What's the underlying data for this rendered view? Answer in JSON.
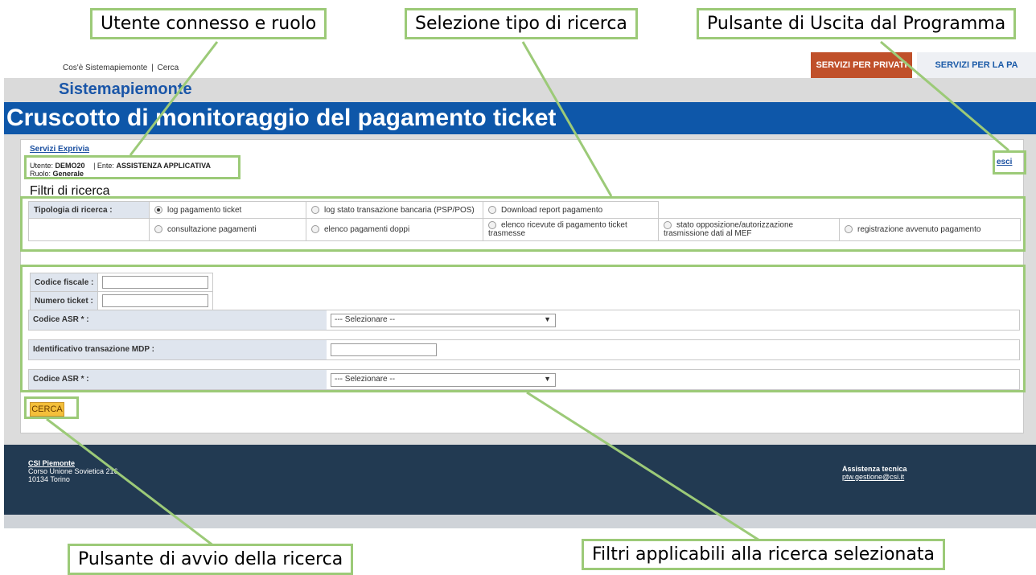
{
  "annotations": {
    "user_role": "Utente connesso e ruolo",
    "search_type": "Selezione tipo di ricerca",
    "exit": "Pulsante di Uscita dal Programma",
    "search_button": "Pulsante di avvio della ricerca",
    "filters": "Filtri applicabili alla ricerca selezionata"
  },
  "topnav": {
    "about": "Cos'è Sistemapiemonte",
    "separator": "|",
    "search": "Cerca",
    "private_services": "SERVIZI PER PRIVATI",
    "pa_services": "SERVIZI PER LA PA"
  },
  "brand": "Sistemapiemonte",
  "title": "Cruscotto di monitoraggio del pagamento ticket",
  "session": {
    "services_link": "Servizi Exprivia",
    "user_label": "Utente:",
    "user": "DEMO20",
    "ente_label": "| Ente:",
    "ente": "ASSISTENZA APPLICATIVA",
    "role_label": "Ruolo:",
    "role": "Generale",
    "exit": "esci"
  },
  "filters_title": "Filtri di ricerca",
  "search_types": {
    "label": "Tipologia di ricerca :",
    "options": [
      "log pagamento ticket",
      "log stato transazione bancaria (PSP/POS)",
      "Download report pagamento",
      "consultazione pagamenti",
      "elenco pagamenti doppi",
      "elenco ricevute di pagamento ticket trasmesse",
      "stato opposizione/autorizzazione trasmissione dati al MEF",
      "registrazione avvenuto pagamento"
    ],
    "selected": "log pagamento ticket"
  },
  "form": {
    "codice_fiscale": "Codice fiscale :",
    "numero_ticket": "Numero ticket :",
    "codice_asr": "Codice ASR * :",
    "select_placeholder": "--- Selezionare --",
    "id_transazione": "Identificativo transazione MDP :",
    "codice_asr_2": "Codice ASR * :",
    "select_placeholder_2": "--- Selezionare --"
  },
  "cerca": "CERCA",
  "footer": {
    "org": "CSI Piemonte",
    "address1": "Corso Unione Sovietica 216",
    "address2": "10134 Torino",
    "support_title": "Assistenza tecnica",
    "support_email": "ptw.gestione@csi.it"
  },
  "colors": {
    "accent_blue": "#0e57a9",
    "callout_green": "#9cca78",
    "private_btn": "#c0502a",
    "cerca_btn": "#f4bf3a",
    "footer": "#223a52"
  }
}
